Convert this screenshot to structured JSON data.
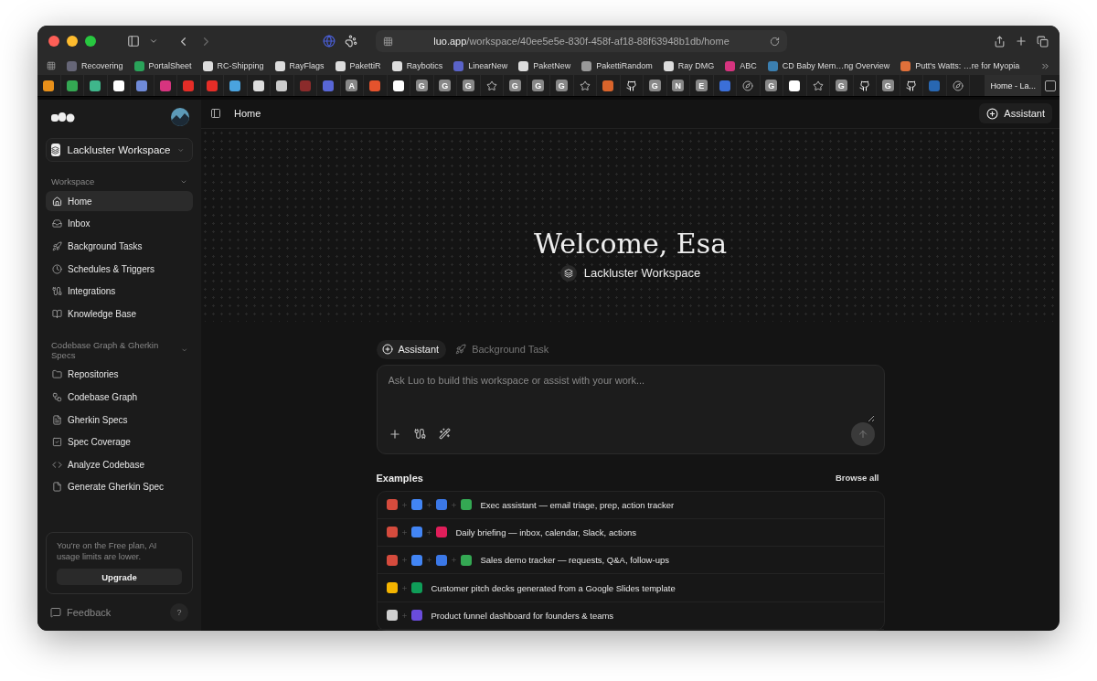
{
  "browser": {
    "address": {
      "host": "luo.app",
      "path": "/workspace/40ee5e5e-830f-458f-af18-88f63948b1db/home"
    },
    "bookmarks": [
      {
        "label": "Recovering"
      },
      {
        "label": "PortalSheet"
      },
      {
        "label": "RC-Shipping"
      },
      {
        "label": "RayFlags"
      },
      {
        "label": "PakettiR"
      },
      {
        "label": "Raybotics"
      },
      {
        "label": "LinearNew"
      },
      {
        "label": "PaketNew"
      },
      {
        "label": "PakettiRandom"
      },
      {
        "label": "Ray DMG"
      },
      {
        "label": "ABC"
      },
      {
        "label": "CD Baby Mem…ng Overview"
      },
      {
        "label": "Putt's Watts: …re for Myopia"
      }
    ],
    "favorites": [
      {
        "kind": "icon",
        "color": "#e8901a"
      },
      {
        "kind": "icon",
        "color": "#34a853"
      },
      {
        "kind": "icon",
        "color": "#3fb68b"
      },
      {
        "kind": "icon",
        "color": "#ffffff"
      },
      {
        "kind": "icon",
        "color": "#6f8ad8"
      },
      {
        "kind": "icon",
        "color": "#d6347f"
      },
      {
        "kind": "icon",
        "color": "#e52d27"
      },
      {
        "kind": "icon",
        "color": "#e52d27"
      },
      {
        "kind": "icon",
        "color": "#4aa3df"
      },
      {
        "kind": "icon",
        "color": "#dddddd"
      },
      {
        "kind": "icon",
        "color": "#cccccc"
      },
      {
        "kind": "icon",
        "color": "#8b2b2b"
      },
      {
        "kind": "icon",
        "color": "#5866d6"
      },
      {
        "kind": "letter",
        "label": "A"
      },
      {
        "kind": "icon",
        "color": "#e5532d"
      },
      {
        "kind": "icon",
        "color": "#ffffff"
      },
      {
        "kind": "letter",
        "label": "G"
      },
      {
        "kind": "letter",
        "label": "G"
      },
      {
        "kind": "letter",
        "label": "G"
      },
      {
        "kind": "star"
      },
      {
        "kind": "letter",
        "label": "G"
      },
      {
        "kind": "letter",
        "label": "G"
      },
      {
        "kind": "letter",
        "label": "G"
      },
      {
        "kind": "star"
      },
      {
        "kind": "icon",
        "color": "#d9642b"
      },
      {
        "kind": "github"
      },
      {
        "kind": "letter",
        "label": "G"
      },
      {
        "kind": "letter",
        "label": "N"
      },
      {
        "kind": "letter",
        "label": "E"
      },
      {
        "kind": "icon",
        "color": "#3b6fd8"
      },
      {
        "kind": "compass"
      },
      {
        "kind": "letter",
        "label": "G"
      },
      {
        "kind": "icon",
        "color": "#ffffff"
      },
      {
        "kind": "star"
      },
      {
        "kind": "letter",
        "label": "G"
      },
      {
        "kind": "github"
      },
      {
        "kind": "letter",
        "label": "G"
      },
      {
        "kind": "github"
      },
      {
        "kind": "icon",
        "color": "#2867b2"
      },
      {
        "kind": "compass"
      }
    ],
    "pinned_tab": {
      "title": "Home - La..."
    }
  },
  "sidebar": {
    "workspace": "Lackluster Workspace",
    "sections": [
      {
        "title": "Workspace",
        "items": [
          {
            "label": "Home",
            "selected": true
          },
          {
            "label": "Inbox",
            "selected": false
          },
          {
            "label": "Background Tasks",
            "selected": false
          },
          {
            "label": "Schedules & Triggers",
            "selected": false
          },
          {
            "label": "Integrations",
            "selected": false
          },
          {
            "label": "Knowledge Base",
            "selected": false
          }
        ]
      },
      {
        "title": "Codebase Graph & Gherkin Specs",
        "items": [
          {
            "label": "Repositories",
            "selected": false
          },
          {
            "label": "Codebase Graph",
            "selected": false
          },
          {
            "label": "Gherkin Specs",
            "selected": false
          },
          {
            "label": "Spec Coverage",
            "selected": false
          },
          {
            "label": "Analyze Codebase",
            "selected": false
          },
          {
            "label": "Generate Gherkin Spec",
            "selected": false
          }
        ]
      }
    ],
    "plan": {
      "text": "You're on the Free plan, AI usage limits are lower.",
      "button": "Upgrade"
    },
    "feedback": "Feedback",
    "help": "?"
  },
  "header": {
    "breadcrumb": "Home",
    "assistant_button": "Assistant"
  },
  "hero": {
    "title": "Welcome, Esa",
    "workspace": "Lackluster Workspace"
  },
  "composer": {
    "tabs": [
      {
        "label": "Assistant",
        "selected": true
      },
      {
        "label": "Background Task",
        "selected": false
      }
    ],
    "placeholder": "Ask Luo to build this workspace or assist with your work..."
  },
  "examples": {
    "title": "Examples",
    "browse": "Browse all",
    "rows": [
      {
        "label": "Exec assistant — email triage, prep, action tracker",
        "apps": [
          {
            "kind": "gmail"
          },
          {
            "kind": "calendar"
          },
          {
            "kind": "docs"
          },
          {
            "kind": "meet"
          }
        ]
      },
      {
        "label": "Daily briefing — inbox, calendar, Slack, actions",
        "apps": [
          {
            "kind": "gmail"
          },
          {
            "kind": "calendar"
          },
          {
            "kind": "slack"
          }
        ]
      },
      {
        "label": "Sales demo tracker — requests, Q&A, follow-ups",
        "apps": [
          {
            "kind": "gmail"
          },
          {
            "kind": "calendar"
          },
          {
            "kind": "docs"
          },
          {
            "kind": "meet"
          }
        ]
      },
      {
        "label": "Customer pitch decks generated from a Google Slides template",
        "apps": [
          {
            "kind": "slides"
          },
          {
            "kind": "drive"
          }
        ]
      },
      {
        "label": "Product funnel dashboard for founders & teams",
        "apps": [
          {
            "kind": "chart"
          },
          {
            "kind": "cross"
          }
        ]
      }
    ]
  }
}
